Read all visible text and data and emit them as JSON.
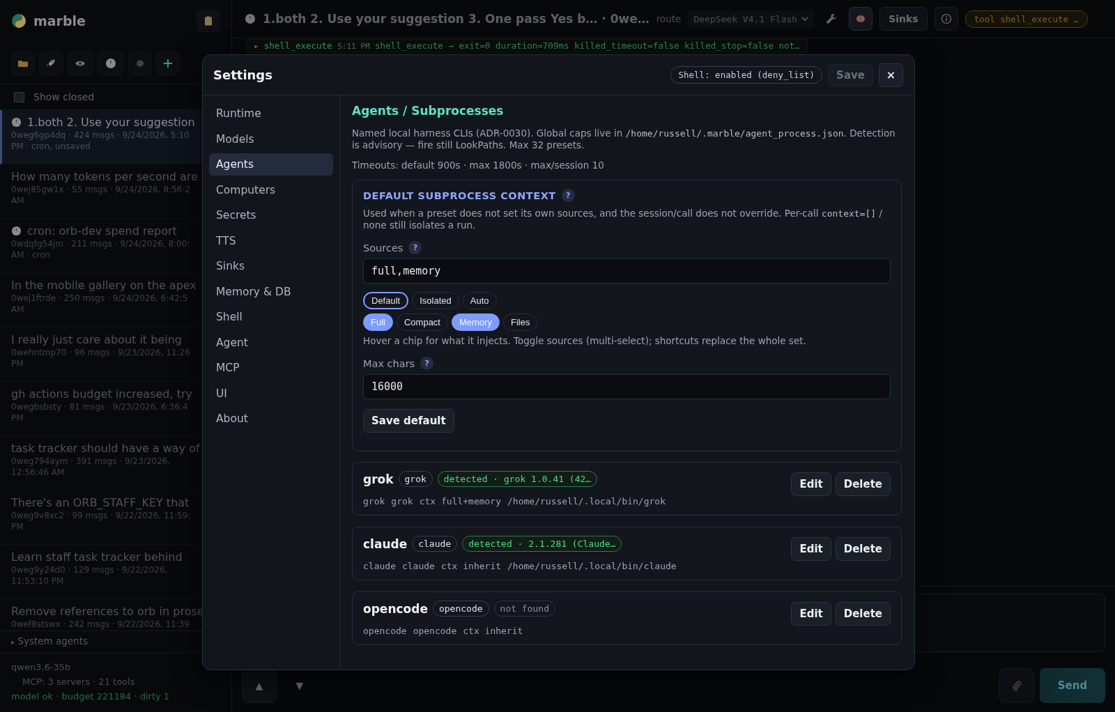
{
  "app": {
    "name": "marble"
  },
  "sidebar": {
    "show_closed": {
      "label": "Show closed",
      "checked": false
    },
    "sessions": [
      {
        "title": "1.both 2. Use your suggestion",
        "meta": [
          "0weg6gp4dq · 424 msgs · 9/24/2026, 5:10",
          "PM · cron, unsaved"
        ],
        "cron": true,
        "selected": true
      },
      {
        "title": "How many tokens per second are",
        "meta": [
          "0wej85gw1x · 55 msgs · 9/24/2026, 8:56:2",
          "AM"
        ],
        "cron": false,
        "selected": false
      },
      {
        "title": "cron: orb-dev spend report",
        "meta": [
          "0wdqfg54jm · 211 msgs · 9/24/2026, 8:00:",
          "AM · cron"
        ],
        "cron": true,
        "selected": false
      },
      {
        "title": "In the mobile gallery on the apex",
        "meta": [
          "0wej1ftrde · 250 msgs · 9/24/2026, 6:42:5",
          "AM"
        ],
        "cron": false,
        "selected": false
      },
      {
        "title": "I really just care about it being",
        "meta": [
          "0wehntmp70 · 96 msgs · 9/23/2026, 11:26",
          "PM"
        ],
        "cron": false,
        "selected": false
      },
      {
        "title": "gh actions budget increased, try",
        "meta": [
          "0wegbsbsty · 81 msgs · 9/23/2026, 6:36:4",
          "PM"
        ],
        "cron": false,
        "selected": false
      },
      {
        "title": "task tracker should have a way of",
        "meta": [
          "0weg794aym · 391 msgs · 9/23/2026,",
          "12:56:46 AM"
        ],
        "cron": false,
        "selected": false
      },
      {
        "title": "There's an ORB_STAFF_KEY that",
        "meta": [
          "0weg9v8xc2 · 99 msgs · 9/22/2026, 11:59:",
          "PM"
        ],
        "cron": false,
        "selected": false
      },
      {
        "title": "Learn staff task tracker behind",
        "meta": [
          "0weg9y24d0 · 129 msgs · 9/22/2026,",
          "11:53:10 PM"
        ],
        "cron": false,
        "selected": false
      },
      {
        "title": "Remove references to orb in prose",
        "meta": [
          "0wef8stswx · 242 msgs · 9/22/2026, 11:39"
        ],
        "cron": false,
        "selected": false
      }
    ],
    "system_agents": {
      "marker": "▸",
      "label": "System agents",
      "expanded": false
    },
    "footer": {
      "model": "qwen3.6-35b",
      "mcp": "MCP: 3 servers · 21 tools",
      "status": "model ok · budget 221184 · dirty 1"
    }
  },
  "topbar": {
    "title": "1.both 2. Use your suggestion 3. One pass Yes b… · 0we…",
    "route_label": "route",
    "model": "DeepSeek V4.1 Flash",
    "sinks": "Sinks",
    "tool_pill": "tool shell_execute …"
  },
  "log": {
    "marker": "▸",
    "tool": "shell_execute",
    "time": "5:11 PM",
    "text": "shell_execute → exit=0 duration=709ms killed_timeout=false killed_stop=false not…"
  },
  "composer": {
    "send": "Send",
    "up": "▲",
    "down": "▼"
  },
  "settings": {
    "title": "Settings",
    "shell_badge": "Shell: enabled (deny_list)",
    "save": "Save",
    "close": "×",
    "nav": [
      {
        "label": "Runtime",
        "selected": false
      },
      {
        "label": "Models",
        "selected": false
      },
      {
        "label": "Agents",
        "selected": true
      },
      {
        "label": "Computers",
        "selected": false
      },
      {
        "label": "Secrets",
        "selected": false
      },
      {
        "label": "TTS",
        "selected": false
      },
      {
        "label": "Sinks",
        "selected": false
      },
      {
        "label": "Memory & DB",
        "selected": false
      },
      {
        "label": "Shell",
        "selected": false
      },
      {
        "label": "Agent",
        "selected": false
      },
      {
        "label": "MCP",
        "selected": false
      },
      {
        "label": "UI",
        "selected": false
      },
      {
        "label": "About",
        "selected": false
      }
    ],
    "heading": "Agents / Subprocesses",
    "intro": [
      {
        "kind": "text",
        "text": "Named local harness CLIs (ADR-0030). Global caps live in "
      },
      {
        "kind": "code",
        "text": "/home/russell/.marble/agent_process.json"
      },
      {
        "kind": "text",
        "text": ". Detection is advisory — fire still LookPaths. Max 32 presets."
      }
    ],
    "timeouts": "Timeouts: default 900s · max 1800s · max/session 10",
    "context": {
      "title": "DEFAULT SUBPROCESS CONTEXT",
      "help": "?",
      "description": [
        {
          "kind": "text",
          "text": "Used when a preset does not set its own sources, and the session/call does not override. Per-call "
        },
        {
          "kind": "code",
          "text": "context=[]"
        },
        {
          "kind": "text",
          "text": " / none still isolates a run."
        }
      ],
      "sources_label": "Sources",
      "sources_help": "?",
      "sources_value": "full,memory",
      "shortcuts": [
        {
          "label": "Default",
          "selected": true
        },
        {
          "label": "Isolated",
          "selected": false
        },
        {
          "label": "Auto",
          "selected": false
        }
      ],
      "sources": [
        {
          "label": "Full",
          "selected": true
        },
        {
          "label": "Compact",
          "selected": false
        },
        {
          "label": "Memory",
          "selected": true
        },
        {
          "label": "Files",
          "selected": false
        }
      ],
      "hint": "Hover a chip for what it injects. Toggle sources (multi-select); shortcuts replace the whole set.",
      "max_label": "Max chars",
      "max_help": "?",
      "max_value": "16000",
      "save_default": "Save default"
    },
    "agents": [
      {
        "name": "grok",
        "badge": "grok",
        "status": "detected · grok 1.0.41 (42…",
        "detected": true,
        "meta": [
          "grok",
          "grok",
          "ctx full+memory",
          "/home/russell/.local/bin/grok"
        ],
        "edit": "Edit",
        "delete": "Delete"
      },
      {
        "name": "claude",
        "badge": "claude",
        "status": "detected · 2.1.281 (Claude…",
        "detected": true,
        "meta": [
          "claude",
          "claude",
          "ctx inherit",
          "/home/russell/.local/bin/claude"
        ],
        "edit": "Edit",
        "delete": "Delete"
      },
      {
        "name": "opencode",
        "badge": "opencode",
        "status": "not found",
        "detected": false,
        "meta": [
          "opencode",
          "opencode",
          "ctx inherit"
        ],
        "edit": "Edit",
        "delete": "Delete"
      }
    ]
  }
}
